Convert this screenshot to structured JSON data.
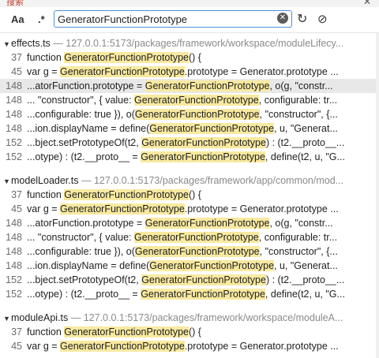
{
  "window": {
    "tab_label": "搜索",
    "close_glyph": "✕"
  },
  "toolbar": {
    "match_case_label": "Aa",
    "regex_label": ".*",
    "search_value": "GeneratorFunctionPrototype",
    "clear_glyph": "✕",
    "refresh_glyph": "↻",
    "block_glyph": "⊘"
  },
  "groups": [
    {
      "file": "effects.ts",
      "path": "127.0.0.1:5173/packages/framework/workspace/moduleLifecy...",
      "matches": [
        {
          "line": "37",
          "pre": "function ",
          "hit": "GeneratorFunctionPrototype",
          "post": "() {",
          "selected": false
        },
        {
          "line": "45",
          "pre": "var g = ",
          "hit": "GeneratorFunctionPrototype",
          "post": ".prototype = Generator.prototype ...",
          "selected": false
        },
        {
          "line": "148",
          "pre": "...atorFunction.prototype = ",
          "hit": "GeneratorFunctionPrototype",
          "post": ", o(g, \"constr...",
          "selected": true
        },
        {
          "line": "148",
          "pre": "... \"constructor\", { value: ",
          "hit": "GeneratorFunctionPrototype",
          "post": ", configurable: tr...",
          "selected": false
        },
        {
          "line": "148",
          "pre": "...configurable: true }), o(",
          "hit": "GeneratorFunctionPrototype",
          "post": ", \"constructor\", {...",
          "selected": false
        },
        {
          "line": "148",
          "pre": "...ion.displayName = define(",
          "hit": "GeneratorFunctionPrototype",
          "post": ", u, \"Generat...",
          "selected": false
        },
        {
          "line": "152",
          "pre": "...bject.setPrototypeOf(t2, ",
          "hit": "GeneratorFunctionPrototype",
          "post": ") : (t2.__proto__...",
          "selected": false
        },
        {
          "line": "152",
          "pre": "...otype) : (t2.__proto__ = ",
          "hit": "GeneratorFunctionPrototype",
          "post": ", define(t2, u, \"G...",
          "selected": false
        }
      ]
    },
    {
      "file": "modelLoader.ts",
      "path": "127.0.0.1:5173/packages/framework/app/common/mod...",
      "matches": [
        {
          "line": "37",
          "pre": "function ",
          "hit": "GeneratorFunctionPrototype",
          "post": "() {",
          "selected": false
        },
        {
          "line": "45",
          "pre": "var g = ",
          "hit": "GeneratorFunctionPrototype",
          "post": ".prototype = Generator.prototype ...",
          "selected": false
        },
        {
          "line": "148",
          "pre": "...atorFunction.prototype = ",
          "hit": "GeneratorFunctionPrototype",
          "post": ", o(g, \"constr...",
          "selected": false
        },
        {
          "line": "148",
          "pre": "... \"constructor\", { value: ",
          "hit": "GeneratorFunctionPrototype",
          "post": ", configurable: tr...",
          "selected": false
        },
        {
          "line": "148",
          "pre": "...configurable: true }), o(",
          "hit": "GeneratorFunctionPrototype",
          "post": ", \"constructor\", {...",
          "selected": false
        },
        {
          "line": "148",
          "pre": "...ion.displayName = define(",
          "hit": "GeneratorFunctionPrototype",
          "post": ", u, \"Generat...",
          "selected": false
        },
        {
          "line": "152",
          "pre": "...bject.setPrototypeOf(t2, ",
          "hit": "GeneratorFunctionPrototype",
          "post": ") : (t2.__proto__...",
          "selected": false
        },
        {
          "line": "152",
          "pre": "...otype) : (t2.__proto__ = ",
          "hit": "GeneratorFunctionPrototype",
          "post": ", define(t2, u, \"G...",
          "selected": false
        }
      ]
    },
    {
      "file": "moduleApi.ts",
      "path": "127.0.0.1:5173/packages/framework/workspace/moduleA...",
      "matches": [
        {
          "line": "37",
          "pre": "function ",
          "hit": "GeneratorFunctionPrototype",
          "post": "() {",
          "selected": false
        },
        {
          "line": "45",
          "pre": "var g = ",
          "hit": "GeneratorFunctionPrototype",
          "post": ".prototype = Generator.prototype ...",
          "selected": false
        }
      ]
    }
  ]
}
